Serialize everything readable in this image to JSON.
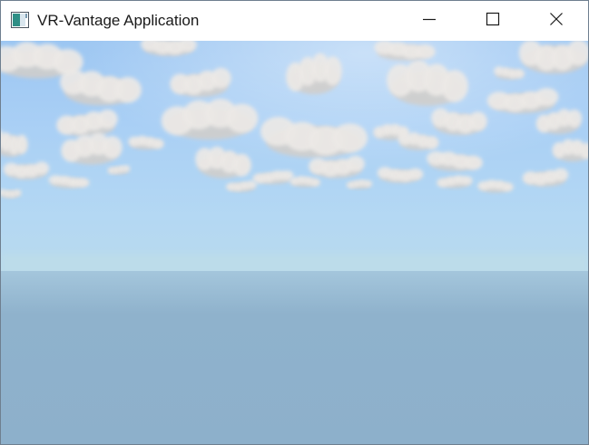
{
  "window": {
    "title": "VR-Vantage Application",
    "icon": "app-window-icon",
    "controls": {
      "minimize_icon": "minimize-icon",
      "maximize_icon": "maximize-icon",
      "close_icon": "close-icon"
    }
  },
  "scene": {
    "colors": {
      "sky_top": "#9ec7f3",
      "sky_mid": "#b3d6f5",
      "horizon_haze": "#b9d9ec",
      "ground": "#8eb1cc",
      "cloud": "#ece9e6",
      "cloud_shadow": "#d2cec9"
    }
  }
}
